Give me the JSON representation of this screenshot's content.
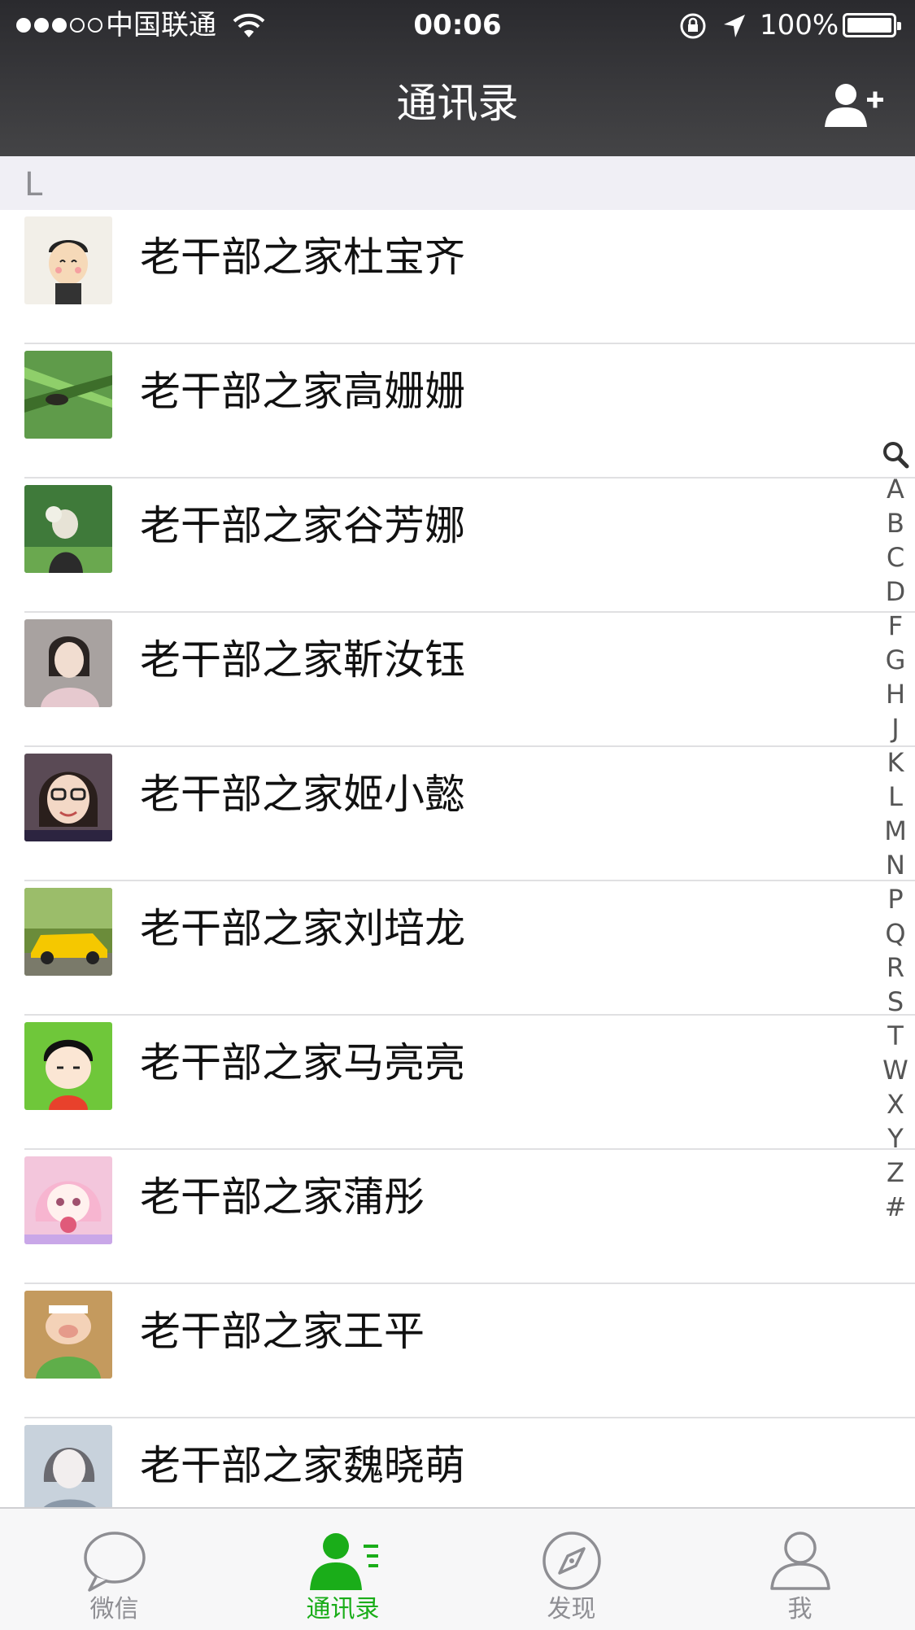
{
  "status_bar": {
    "carrier": "中国联通",
    "time": "00:06",
    "battery": "100%"
  },
  "nav": {
    "title": "通讯录"
  },
  "section_header": "L",
  "contacts": [
    {
      "name": "老干部之家杜宝齐",
      "avatar_color": "#f2efe8"
    },
    {
      "name": "老干部之家高姗姗",
      "avatar_color": "#5f9b4a"
    },
    {
      "name": "老干部之家谷芳娜",
      "avatar_color": "#3f7a3a"
    },
    {
      "name": "老干部之家靳汝钰",
      "avatar_color": "#a8a2a0"
    },
    {
      "name": "老干部之家姬小懿",
      "avatar_color": "#5a4a55"
    },
    {
      "name": "老干部之家刘培龙",
      "avatar_color": "#6b8c3a"
    },
    {
      "name": "老干部之家马亮亮",
      "avatar_color": "#6fc73a"
    },
    {
      "name": "老干部之家蒲彤",
      "avatar_color": "#f3c6dc"
    },
    {
      "name": "老干部之家王平",
      "avatar_color": "#c49a5e"
    },
    {
      "name": "老干部之家魏晓萌",
      "avatar_color": "#c8d2dc"
    }
  ],
  "index_letters": [
    "A",
    "B",
    "C",
    "D",
    "F",
    "G",
    "H",
    "J",
    "K",
    "L",
    "M",
    "N",
    "P",
    "Q",
    "R",
    "S",
    "T",
    "W",
    "X",
    "Y",
    "Z",
    "#"
  ],
  "tabs": [
    {
      "label": "微信",
      "icon": "chat-bubble-icon"
    },
    {
      "label": "通讯录",
      "icon": "contacts-icon",
      "active": true
    },
    {
      "label": "发现",
      "icon": "compass-icon"
    },
    {
      "label": "我",
      "icon": "person-icon"
    }
  ],
  "colors": {
    "accent": "#1aad19",
    "nav_bg": "#39393b",
    "section_bg": "#f0eff5",
    "inactive_tab": "#8e8e93"
  }
}
